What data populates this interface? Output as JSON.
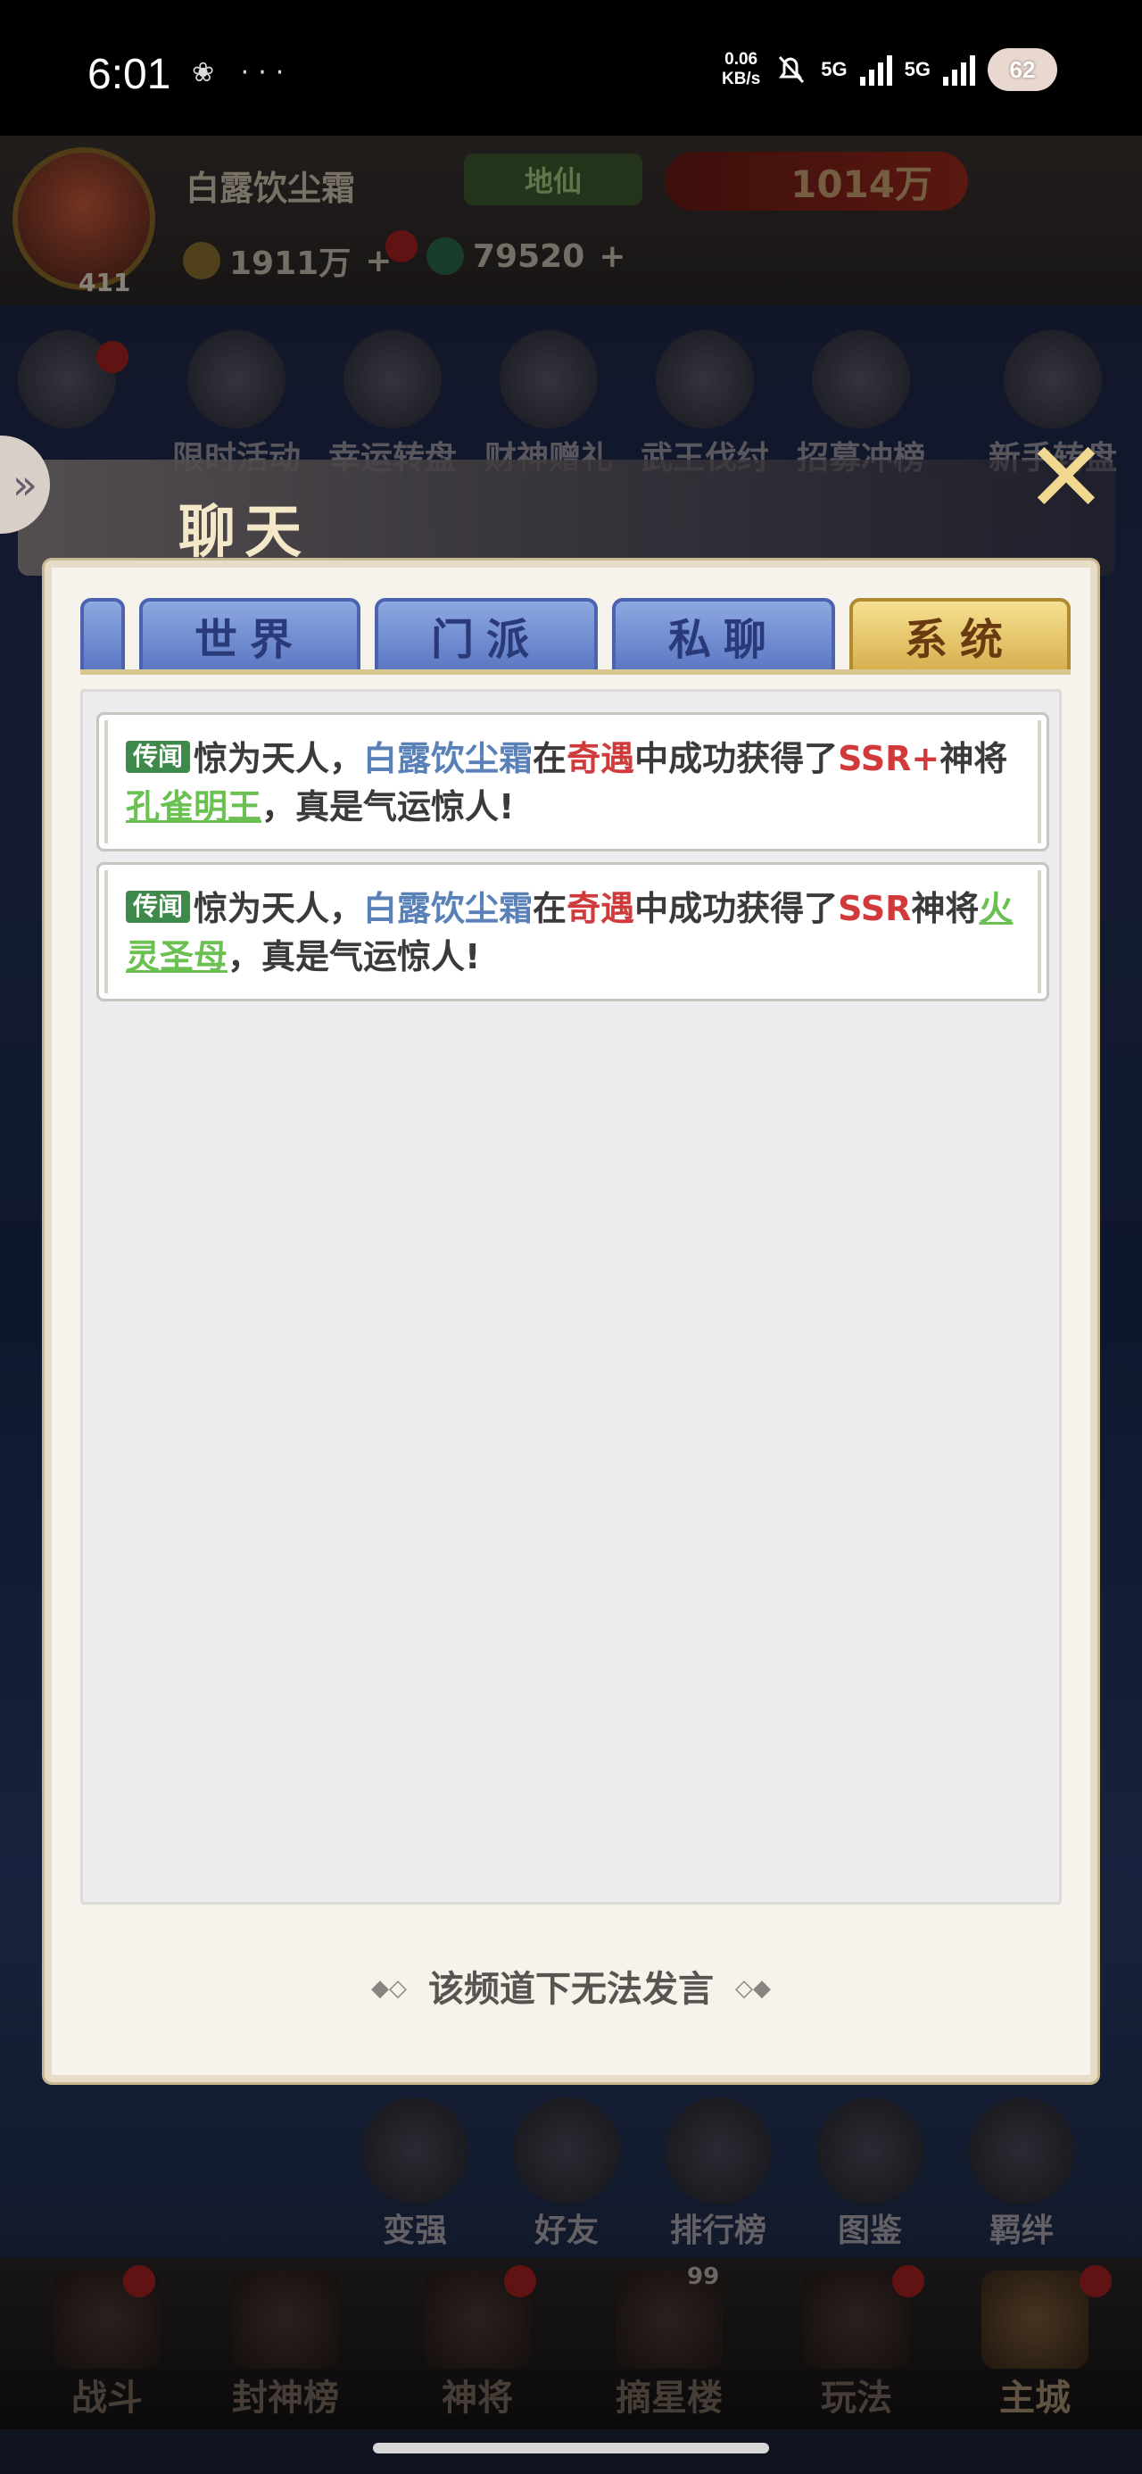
{
  "status_bar": {
    "time": "6:01",
    "left_icons": "❀ ···",
    "speed_value": "0.06",
    "speed_unit": "KB/s",
    "network1": "5G",
    "network2": "5G",
    "battery": "62"
  },
  "player": {
    "name": "白露饮尘霜",
    "level": "411",
    "rank": "地仙",
    "power": "1014万",
    "gold": "1911万",
    "jade": "79520",
    "plus": "+"
  },
  "top_icons": [
    {
      "label": "限时活动"
    },
    {
      "label": "幸运转盘"
    },
    {
      "label": "财神赠礼"
    },
    {
      "label": "武王伐纣"
    },
    {
      "label": "招募冲榜"
    },
    {
      "label": "新手转盘"
    }
  ],
  "chat": {
    "title": "聊天",
    "close": "✕",
    "side_arrow": "»",
    "tabs": [
      {
        "label": "世界",
        "active": false
      },
      {
        "label": "门派",
        "active": false
      },
      {
        "label": "私聊",
        "active": false
      },
      {
        "label": "系统",
        "active": true
      }
    ],
    "messages": [
      {
        "tag": "传闻",
        "prefix": "惊为天人，",
        "player": "白露饮尘霜",
        "in": "在",
        "source": "奇遇",
        "mid": "中成功获得了",
        "rarity": "SSR+",
        "god": "神将",
        "hero": "孔雀明王",
        "suffix": "，真是气运惊人!"
      },
      {
        "tag": "传闻",
        "prefix": "惊为天人，",
        "player": "白露饮尘霜",
        "in": "在",
        "source": "奇遇",
        "mid": "中成功获得了",
        "rarity": "SSR",
        "god": "神将",
        "hero": "火灵圣母",
        "suffix": "，真是气运惊人!"
      }
    ],
    "footer": "该频道下无法发言"
  },
  "bottom_icons": [
    {
      "label": "变强"
    },
    {
      "label": "好友"
    },
    {
      "label": "排行榜"
    },
    {
      "label": "图鉴"
    },
    {
      "label": "羁绊"
    }
  ],
  "nav": [
    {
      "label": "战斗"
    },
    {
      "label": "封神榜"
    },
    {
      "label": "神将"
    },
    {
      "label": "摘星楼",
      "badge": "99"
    },
    {
      "label": "玩法"
    },
    {
      "label": "主城"
    }
  ],
  "colors": {
    "blue_tab": "#5c78c4",
    "gold_tab": "#d8b050",
    "tag_green": "#3f8a4a",
    "name_blue": "#5a80b8",
    "highlight_red": "#d03a3a",
    "hero_green": "#6ac050"
  }
}
